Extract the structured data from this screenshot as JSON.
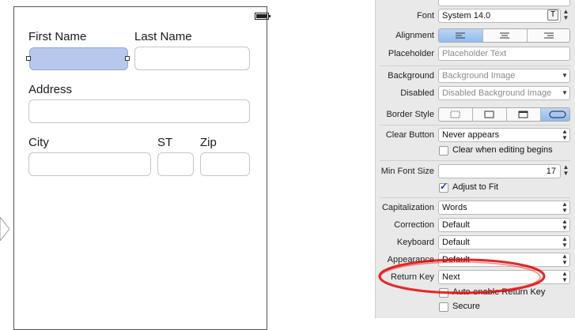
{
  "form": {
    "first_name_label": "First Name",
    "last_name_label": "Last Name",
    "address_label": "Address",
    "city_label": "City",
    "state_label": "ST",
    "zip_label": "Zip"
  },
  "inspector": {
    "font": {
      "label": "Font",
      "value": "System 14.0",
      "button": "T"
    },
    "alignment": {
      "label": "Alignment",
      "selected": "left"
    },
    "placeholder": {
      "label": "Placeholder",
      "value": "Placeholder Text"
    },
    "background": {
      "label": "Background",
      "value": "Background Image"
    },
    "disabled": {
      "label": "Disabled",
      "value": "Disabled Background Image"
    },
    "border_style": {
      "label": "Border Style",
      "selected": "rounded-rect"
    },
    "clear_button": {
      "label": "Clear Button",
      "value": "Never appears"
    },
    "clear_when_editing": {
      "label": "Clear when editing begins",
      "checked": false
    },
    "min_font_size": {
      "label": "Min Font Size",
      "value": "17"
    },
    "adjust_to_fit": {
      "label": "Adjust to Fit",
      "checked": true
    },
    "capitalization": {
      "label": "Capitalization",
      "value": "Words"
    },
    "correction": {
      "label": "Correction",
      "value": "Default"
    },
    "keyboard": {
      "label": "Keyboard",
      "value": "Default"
    },
    "appearance": {
      "label": "Appearance",
      "value": "Default"
    },
    "return_key": {
      "label": "Return Key",
      "value": "Next"
    },
    "auto_enable_return_key": {
      "label": "Auto-enable Return Key",
      "checked": false
    },
    "secure": {
      "label": "Secure",
      "checked": false
    },
    "colors": {
      "selected_field": "#b8c8ec",
      "segment_on": "#8fbbef",
      "annotation": "#e00000"
    }
  }
}
